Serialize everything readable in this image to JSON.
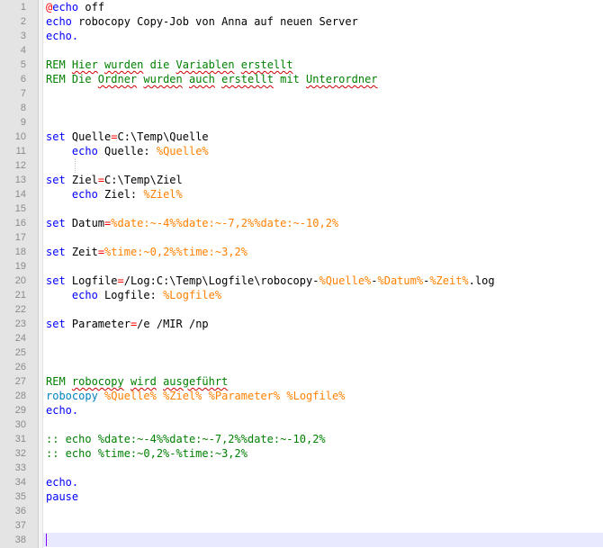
{
  "colors": {
    "keyword": "#0000ff",
    "echo_at": "#ff0000",
    "variable": "#ff8000",
    "comment": "#008000",
    "command": "#0080c0",
    "operator": "#ff0000",
    "gutter_bg": "#e4e4e4",
    "current_line_bg": "#e8e8ff",
    "caret": "#8000ff"
  },
  "editor": {
    "current_line": 38,
    "lines": [
      {
        "n": "1",
        "tokens": [
          {
            "t": "@",
            "c": "at"
          },
          {
            "t": "echo",
            "c": "kw"
          },
          {
            "t": " off"
          }
        ]
      },
      {
        "n": "2",
        "tokens": [
          {
            "t": "echo",
            "c": "kw"
          },
          {
            "t": " robocopy Copy-Job von Anna auf neuen Server"
          }
        ]
      },
      {
        "n": "3",
        "tokens": [
          {
            "t": "echo.",
            "c": "kw"
          }
        ]
      },
      {
        "n": "4",
        "tokens": []
      },
      {
        "n": "5",
        "tokens": [
          {
            "t": "REM ",
            "c": "rem"
          },
          {
            "t": "Hier",
            "c": "rem sq"
          },
          {
            "t": " ",
            "c": "rem"
          },
          {
            "t": "wurden",
            "c": "rem sq"
          },
          {
            "t": " die ",
            "c": "rem"
          },
          {
            "t": "Variablen",
            "c": "rem sq"
          },
          {
            "t": " ",
            "c": "rem"
          },
          {
            "t": "erstellt",
            "c": "rem sq"
          }
        ]
      },
      {
        "n": "6",
        "tokens": [
          {
            "t": "REM Die ",
            "c": "rem"
          },
          {
            "t": "Ordner",
            "c": "rem sq"
          },
          {
            "t": " ",
            "c": "rem"
          },
          {
            "t": "wurden",
            "c": "rem sq"
          },
          {
            "t": " ",
            "c": "rem"
          },
          {
            "t": "auch",
            "c": "rem sq"
          },
          {
            "t": " ",
            "c": "rem"
          },
          {
            "t": "erstellt",
            "c": "rem sq"
          },
          {
            "t": " mit ",
            "c": "rem"
          },
          {
            "t": "Unterordner",
            "c": "rem sq"
          }
        ]
      },
      {
        "n": "7",
        "tokens": []
      },
      {
        "n": "8",
        "tokens": []
      },
      {
        "n": "9",
        "tokens": []
      },
      {
        "n": "10",
        "tokens": [
          {
            "t": "set",
            "c": "kw"
          },
          {
            "t": " Quelle"
          },
          {
            "t": "=",
            "c": "op"
          },
          {
            "t": "C:\\Temp\\Quelle"
          }
        ]
      },
      {
        "n": "11",
        "tokens": [
          {
            "t": "    "
          },
          {
            "t": "echo",
            "c": "kw"
          },
          {
            "t": " Quelle: "
          },
          {
            "t": "%Quelle%",
            "c": "var"
          }
        ]
      },
      {
        "n": "12",
        "tokens": [],
        "guide": true
      },
      {
        "n": "13",
        "tokens": [
          {
            "t": "set",
            "c": "kw"
          },
          {
            "t": " Ziel"
          },
          {
            "t": "=",
            "c": "op"
          },
          {
            "t": "C:\\Temp\\Ziel"
          }
        ]
      },
      {
        "n": "14",
        "tokens": [
          {
            "t": "    "
          },
          {
            "t": "echo",
            "c": "kw"
          },
          {
            "t": " Ziel: "
          },
          {
            "t": "%Ziel%",
            "c": "var"
          }
        ]
      },
      {
        "n": "15",
        "tokens": []
      },
      {
        "n": "16",
        "tokens": [
          {
            "t": "set",
            "c": "kw"
          },
          {
            "t": " Datum"
          },
          {
            "t": "=",
            "c": "op"
          },
          {
            "t": "%date:~-4%%date:~-7,2%%date:~-10,2%",
            "c": "var"
          }
        ]
      },
      {
        "n": "17",
        "tokens": []
      },
      {
        "n": "18",
        "tokens": [
          {
            "t": "set",
            "c": "kw"
          },
          {
            "t": " Zeit"
          },
          {
            "t": "=",
            "c": "op"
          },
          {
            "t": "%time:~0,2%%time:~3,2%",
            "c": "var"
          }
        ]
      },
      {
        "n": "19",
        "tokens": []
      },
      {
        "n": "20",
        "tokens": [
          {
            "t": "set",
            "c": "kw"
          },
          {
            "t": " Logfile"
          },
          {
            "t": "=",
            "c": "op"
          },
          {
            "t": "/Log:C:\\Temp\\Logfile\\robocopy-"
          },
          {
            "t": "%Quelle%",
            "c": "var"
          },
          {
            "t": "-"
          },
          {
            "t": "%Datum%",
            "c": "var"
          },
          {
            "t": "-"
          },
          {
            "t": "%Zeit%",
            "c": "var"
          },
          {
            "t": ".log"
          }
        ]
      },
      {
        "n": "21",
        "tokens": [
          {
            "t": "    "
          },
          {
            "t": "echo",
            "c": "kw"
          },
          {
            "t": " Logfile: "
          },
          {
            "t": "%Logfile%",
            "c": "var"
          }
        ]
      },
      {
        "n": "22",
        "tokens": []
      },
      {
        "n": "23",
        "tokens": [
          {
            "t": "set",
            "c": "kw"
          },
          {
            "t": " Parameter"
          },
          {
            "t": "=",
            "c": "op"
          },
          {
            "t": "/e /MIR /np"
          }
        ]
      },
      {
        "n": "24",
        "tokens": []
      },
      {
        "n": "25",
        "tokens": []
      },
      {
        "n": "26",
        "tokens": []
      },
      {
        "n": "27",
        "tokens": [
          {
            "t": "REM ",
            "c": "rem"
          },
          {
            "t": "robocopy",
            "c": "rem sq"
          },
          {
            "t": " ",
            "c": "rem"
          },
          {
            "t": "wird",
            "c": "rem sq"
          },
          {
            "t": " ",
            "c": "rem"
          },
          {
            "t": "ausgeführt",
            "c": "rem sq"
          }
        ]
      },
      {
        "n": "28",
        "tokens": [
          {
            "t": "robocopy",
            "c": "cmd"
          },
          {
            "t": " "
          },
          {
            "t": "%Quelle%",
            "c": "var"
          },
          {
            "t": " "
          },
          {
            "t": "%Ziel%",
            "c": "var"
          },
          {
            "t": " "
          },
          {
            "t": "%Parameter%",
            "c": "var"
          },
          {
            "t": " "
          },
          {
            "t": "%Logfile%",
            "c": "var"
          }
        ]
      },
      {
        "n": "29",
        "tokens": [
          {
            "t": "echo.",
            "c": "kw"
          }
        ]
      },
      {
        "n": "30",
        "tokens": []
      },
      {
        "n": "31",
        "tokens": [
          {
            "t": ":: echo %date:~-4%%date:~-7,2%%date:~-10,2%",
            "c": "rem"
          }
        ]
      },
      {
        "n": "32",
        "tokens": [
          {
            "t": ":: echo %time:~0,2%-%time:~3,2%",
            "c": "rem"
          }
        ]
      },
      {
        "n": "33",
        "tokens": []
      },
      {
        "n": "34",
        "tokens": [
          {
            "t": "echo.",
            "c": "kw"
          }
        ]
      },
      {
        "n": "35",
        "tokens": [
          {
            "t": "pause",
            "c": "kw"
          }
        ]
      },
      {
        "n": "36",
        "tokens": []
      },
      {
        "n": "37",
        "tokens": []
      },
      {
        "n": "38",
        "tokens": []
      }
    ]
  }
}
